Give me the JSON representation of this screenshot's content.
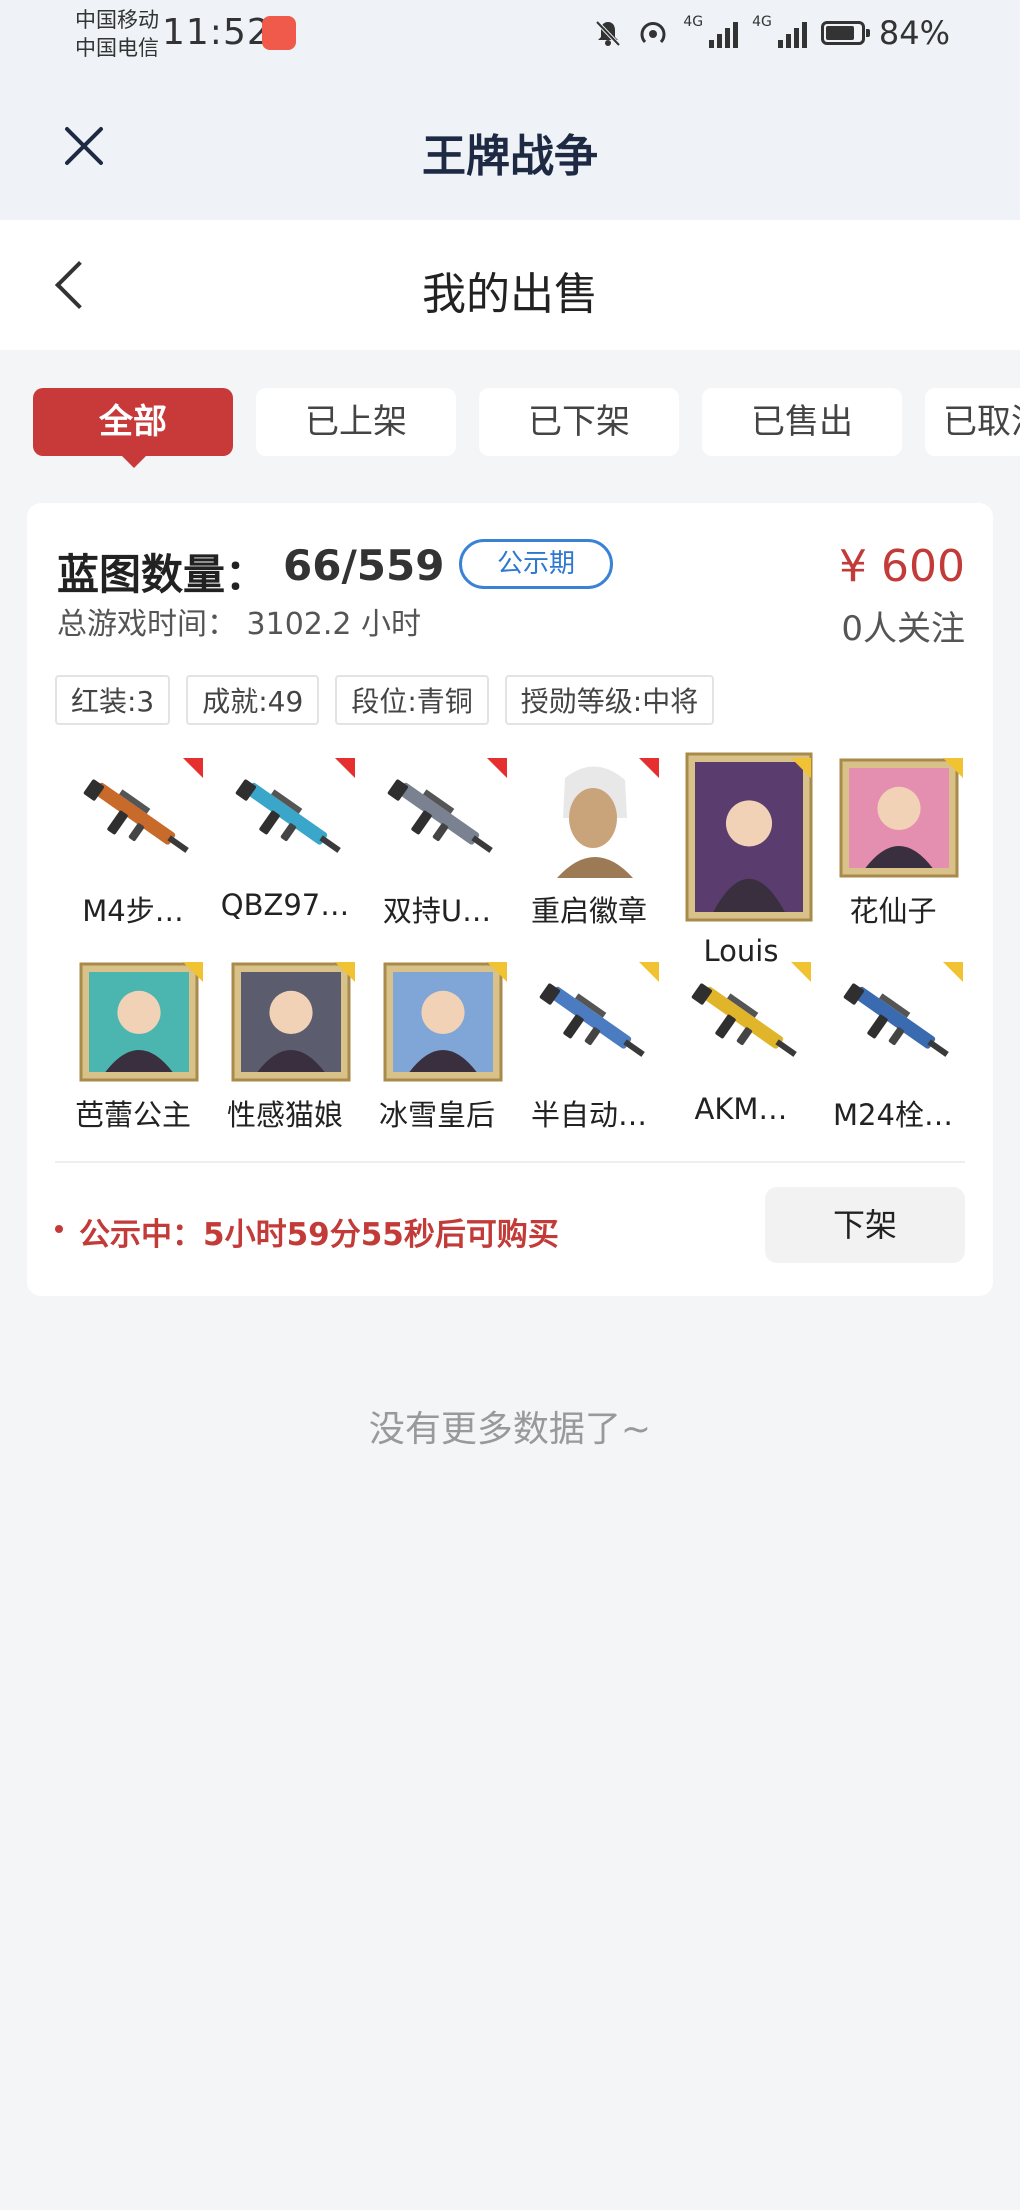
{
  "status_bar": {
    "carrier1": "中国移动",
    "carrier2": "中国电信",
    "time": "11:52",
    "net1": "4G",
    "net2": "4G",
    "battery_percent": 84,
    "battery_label": "84%"
  },
  "app": {
    "title": "王牌战争"
  },
  "nav": {
    "title": "我的出售"
  },
  "tabs": [
    {
      "label": "全部",
      "active": true
    },
    {
      "label": "已上架",
      "active": false
    },
    {
      "label": "已下架",
      "active": false
    },
    {
      "label": "已售出",
      "active": false
    },
    {
      "label": "已取消",
      "active": false
    }
  ],
  "listing": {
    "blueprint_label": "蓝图数量：",
    "blueprint_count": "66/559",
    "status_badge": "公示期",
    "price": "¥ 600",
    "followers": "0人关注",
    "playtime": "总游戏时间：  3102.2 小时",
    "tags": [
      "红装:3",
      "成就:49",
      "段位:青铜",
      "授勋等级:中将"
    ],
    "items": [
      {
        "label": "M4步…",
        "type": "gun",
        "color": "#c86a2a",
        "corner": "red"
      },
      {
        "label": "QBZ97…",
        "type": "gun",
        "color": "#3aa6c9",
        "corner": "red"
      },
      {
        "label": "双持U…",
        "type": "gun",
        "color": "#7a8190",
        "corner": "red"
      },
      {
        "label": "重启徽章",
        "type": "portrait",
        "color": "#c9a47a",
        "corner": "red"
      },
      {
        "label": "Louis",
        "type": "card",
        "color": "#5a3d6e",
        "corner": "gold"
      },
      {
        "label": "花仙子",
        "type": "card",
        "color": "#e58fb0",
        "corner": "gold"
      },
      {
        "label": "芭蕾公主",
        "type": "card",
        "color": "#4bb6b0",
        "corner": "gold"
      },
      {
        "label": "性感猫娘",
        "type": "card",
        "color": "#5b5c6e",
        "corner": "gold"
      },
      {
        "label": "冰雪皇后",
        "type": "card",
        "color": "#7fa6d6",
        "corner": "gold"
      },
      {
        "label": "半自动…",
        "type": "gun",
        "color": "#4b7bc0",
        "corner": "gold"
      },
      {
        "label": "AKM…",
        "type": "gun",
        "color": "#e0b52a",
        "corner": "gold"
      },
      {
        "label": "M24栓…",
        "type": "gun",
        "color": "#3a6bb0",
        "corner": "gold"
      }
    ],
    "notice": "公示中：5小时59分55秒后可购买",
    "delist_button": "下架"
  },
  "footer": {
    "no_more": "没有更多数据了~"
  }
}
